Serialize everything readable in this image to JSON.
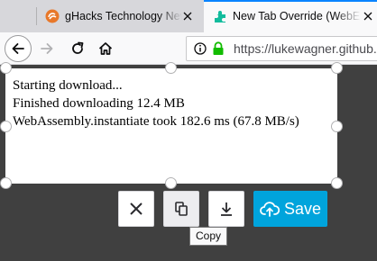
{
  "tabs": [
    {
      "title": "gHacks Technology News",
      "favicon": "ghacks-icon",
      "active": false
    },
    {
      "title": "New Tab Override (WebExtension)",
      "favicon": "puzzle-piece-icon",
      "active": true
    }
  ],
  "navbar": {
    "url": "https://lukewagner.github.io"
  },
  "log": {
    "lines": [
      "Starting download...",
      "Finished downloading 12.4 MB",
      "WebAssembly.instantiate took 182.6 ms (67.8 MB/s)"
    ]
  },
  "toolbar": {
    "cancel_icon": "close-icon",
    "copy_icon": "copy-icon",
    "download_icon": "download-icon",
    "save_label": "Save",
    "save_color": "#00a4dc",
    "copy_tooltip": "Copy"
  },
  "colors": {
    "background": "#404040",
    "active_tab_accent": "#0a84ff"
  }
}
